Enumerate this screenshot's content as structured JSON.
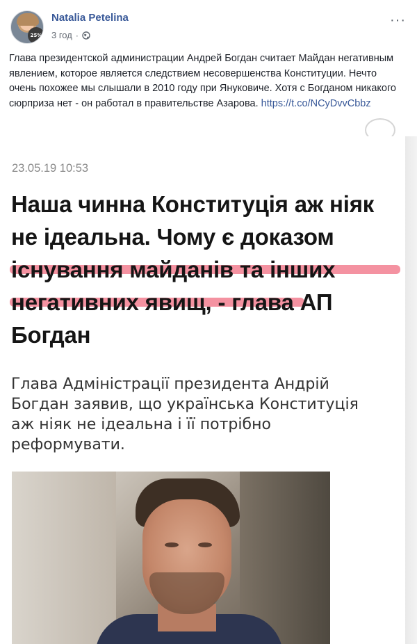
{
  "post": {
    "author": "Natalia Petelina",
    "time": "3 год",
    "separator": "·",
    "privacy_icon": "globe-icon",
    "avatar_badge": "25%",
    "more_icon": "more-options-icon",
    "more_label": "···",
    "text": "Глава президентской администрации Андрей Богдан считает Майдан негативным явлением, которое является следствием несовершенства Конституции. Нечто очень похожее мы слышали в 2010 году при Януковиче. Хотя с Богданом никакого сюрприза нет - он работал в правительстве Азарова.",
    "link": "https://t.co/NCyDvvCbbz"
  },
  "embed": {
    "timestamp": "23.05.19 10:53",
    "headline_part1": "Наша чинна Конституція аж ніяк не ідеальна. Чому є",
    "headline_highlight1": "доказом існування майданів та",
    "headline_highlight2": "інших негативних явищ,",
    "headline_part2": "- глава АП Богдан",
    "lede": "Глава Адміністрації президента Андрій Богдан заявив, що українська Конституція аж ніяк не ідеальна і її потрібно реформувати.",
    "highlight_color": "#f06e82"
  }
}
